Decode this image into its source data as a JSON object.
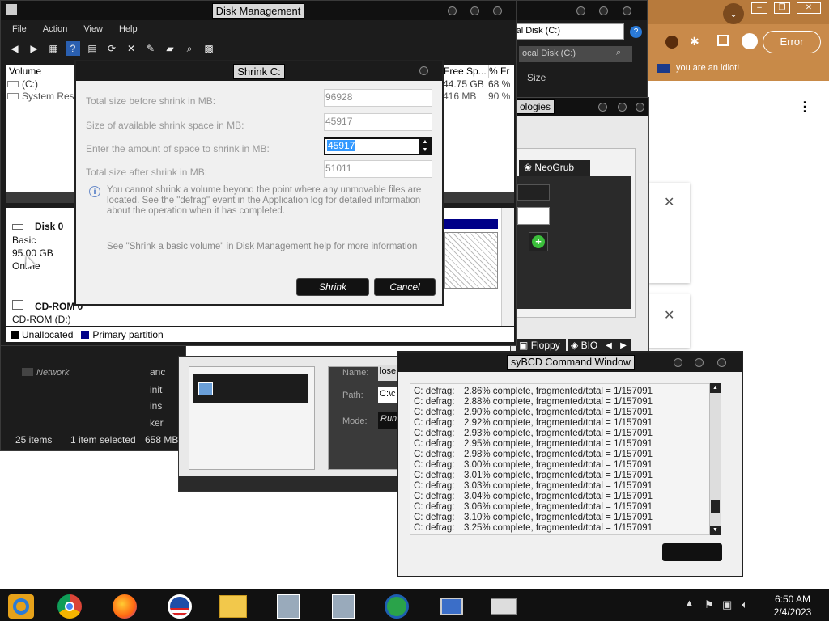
{
  "chrome_bg": {
    "error_button": "Error",
    "tab_label": "you are an idiot!",
    "window_controls": [
      "–",
      "❐",
      "✕"
    ]
  },
  "explorer_right": {
    "address": "ocal Disk (C:)",
    "column_size": "Size",
    "tab_fragment": "ologies",
    "neogrub_tab": "NeoGrub",
    "floppy_tab": "Floppy",
    "bios_tab": "BIO"
  },
  "disk_mgmt": {
    "title": "Disk Management",
    "menu": [
      "File",
      "Action",
      "View",
      "Help"
    ],
    "columns": [
      "Volume",
      "Free Sp...",
      "% Fr"
    ],
    "volumes": [
      {
        "name": "(C:)",
        "free": "44.75 GB",
        "pct": "68 %"
      },
      {
        "name": "System Rese",
        "free": "416 MB",
        "pct": "90 %"
      }
    ],
    "disk0": {
      "name": "Disk 0",
      "type": "Basic",
      "size": "95.00 GB",
      "status": "Online"
    },
    "cdrom": {
      "name": "CD-ROM 0",
      "drive": "CD-ROM (D:)"
    },
    "legend": {
      "unallocated": "Unallocated",
      "primary": "Primary partition"
    }
  },
  "shrink_dialog": {
    "title": "Shrink C:",
    "rows": [
      {
        "label": "Total size before shrink in MB:",
        "value": "96928"
      },
      {
        "label": "Size of available shrink space in MB:",
        "value": "45917"
      },
      {
        "label": "Enter the amount of space to shrink in MB:",
        "value": "45917"
      },
      {
        "label": "Total size after shrink in MB:",
        "value": "51011"
      }
    ],
    "info_text": "You cannot shrink a volume beyond the point where any unmovable files are located. See the \"defrag\" event in the Application log for detailed information about the operation when it has completed.",
    "help_text": "See \"Shrink a basic volume\" in Disk Management help for more information",
    "shrink_button": "Shrink",
    "cancel_button": "Cancel"
  },
  "explorer_left": {
    "network": "Network",
    "files": [
      "anc",
      "init",
      "ins",
      "ker"
    ],
    "status_items": "25 items",
    "status_selected": "1 item selected",
    "status_size": "658 MB",
    "fields": [
      "Name:",
      "Path:",
      "Mode:"
    ],
    "field_values": [
      "lose",
      "C:\\c",
      "Run"
    ]
  },
  "easybcd": {
    "title": "EasyBCD Command Window",
    "title_visible": "syBCD Command Window",
    "lines": [
      {
        "src": "C: defrag:",
        "text": "2.86% complete, fragmented/total = 1/157091"
      },
      {
        "src": "C: defrag:",
        "text": "2.88% complete, fragmented/total = 1/157091"
      },
      {
        "src": "C: defrag:",
        "text": "2.90% complete, fragmented/total = 1/157091"
      },
      {
        "src": "C: defrag:",
        "text": "2.92% complete, fragmented/total = 1/157091"
      },
      {
        "src": "C: defrag:",
        "text": "2.93% complete, fragmented/total = 1/157091"
      },
      {
        "src": "C: defrag:",
        "text": "2.95% complete, fragmented/total = 1/157091"
      },
      {
        "src": "C: defrag:",
        "text": "2.98% complete, fragmented/total = 1/157091"
      },
      {
        "src": "C: defrag:",
        "text": "3.00% complete, fragmented/total = 1/157091"
      },
      {
        "src": "C: defrag:",
        "text": "3.01% complete, fragmented/total = 1/157091"
      },
      {
        "src": "C: defrag:",
        "text": "3.03% complete, fragmented/total = 1/157091"
      },
      {
        "src": "C: defrag:",
        "text": "3.04% complete, fragmented/total = 1/157091"
      },
      {
        "src": "C: defrag:",
        "text": "3.06% complete, fragmented/total = 1/157091"
      },
      {
        "src": "C: defrag:",
        "text": "3.10% complete, fragmented/total = 1/157091"
      },
      {
        "src": "C: defrag:",
        "text": "3.25% complete, fragmented/total = 1/157091"
      }
    ]
  },
  "taskbar": {
    "time": "6:50 AM",
    "date": "2/4/2023",
    "apps": [
      "file-explorer-icon",
      "chrome-icon",
      "firefox-icon",
      "obama-icon",
      "folder-icon",
      "installer-icon",
      "installer2-icon",
      "internet-download-icon",
      "computer-icon",
      "scanner-icon"
    ]
  }
}
